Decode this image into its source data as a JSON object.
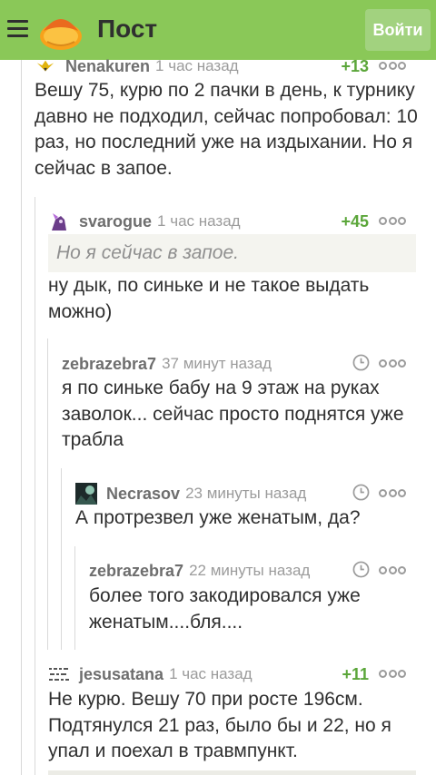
{
  "header": {
    "title": "Пост",
    "login_label": "Войти",
    "accent_color": "#8ac858"
  },
  "comments": [
    {
      "author": "Nenakuren",
      "time": "1 час назад",
      "rating": "+13",
      "text": "Вешу 75, курю по 2 пачки в день, к турнику давно не подходил, сейчас попробовал: 10 раз, но последний уже на издыхании. Но я сейчас в запое."
    },
    {
      "author": "svarogue",
      "time": "1 час назад",
      "rating": "+45",
      "quote": "Но я сейчас в запое.",
      "text": "ну дык, по синьке и не такое выдать можно)"
    },
    {
      "author": "zebrazebra7",
      "time": "37 минут назад",
      "text": "я по синьке бабу на 9 этаж на руках заволок... сейчас просто поднятся уже трабла"
    },
    {
      "author": "Necrasov",
      "time": "23 минуты назад",
      "text": "А протрезвел уже женатым, да?"
    },
    {
      "author": "zebrazebra7",
      "time": "22 минуты назад",
      "text": "более того закодировался уже женатым....бля...."
    },
    {
      "author": "jesusatana",
      "time": "1 час назад",
      "rating": "+11",
      "text": "Не курю. Вешу 70 при росте 196см. Подтянулся 21 раз, было бы и 22, но я упал и поехал в травмпункт."
    }
  ],
  "icons": {
    "menu": "hamburger-icon",
    "logo": "pikabu-logo",
    "more": "more-dots-icon",
    "time": "clock-icon"
  }
}
